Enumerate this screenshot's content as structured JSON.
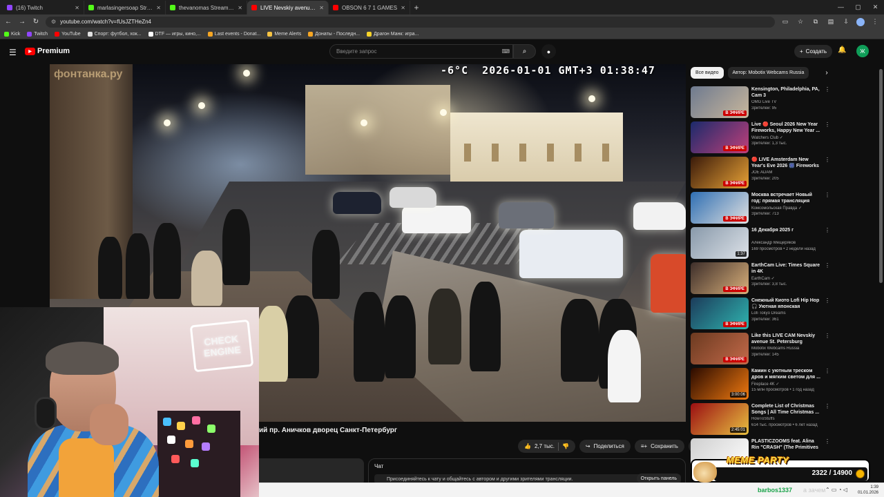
{
  "browser": {
    "tabs": [
      {
        "label": "(16) Twitch",
        "color": "#9146ff",
        "active": false
      },
      {
        "label": "marlasingersoap Stream - Watc",
        "color": "#53fc18",
        "active": false
      },
      {
        "label": "thevanomas Stream - Watch Li",
        "color": "#53fc18",
        "active": false
      },
      {
        "label": "LIVE Nevskiy avenue St. Pe",
        "color": "#ff0000",
        "active": true
      },
      {
        "label": "OBSON 6 7 1 GAMES",
        "color": "#ff0000",
        "active": false
      }
    ],
    "url": "youtube.com/watch?v=fUsJZTHeZn4",
    "bookmarks": [
      {
        "label": "Kick",
        "color": "#53fc18"
      },
      {
        "label": "Twitch",
        "color": "#9146ff"
      },
      {
        "label": "YouTube",
        "color": "#ff0000"
      },
      {
        "label": "Спорт: футбол, хок...",
        "color": "#e0e0e0"
      },
      {
        "label": "DTF — игры, кино,...",
        "color": "#ffffff"
      },
      {
        "label": "Last events - Donat...",
        "color": "#f6a623"
      },
      {
        "label": "Meme Alerts",
        "color": "#f6c343"
      },
      {
        "label": "Донаты - Последн...",
        "color": "#f6a623"
      },
      {
        "label": "Драгон Манк: игра...",
        "color": "#f6d32a"
      }
    ]
  },
  "youtube": {
    "logo_text": "Premium",
    "search_placeholder": "Введите запрос",
    "create_label": "Создать",
    "user_initial": "Ж"
  },
  "video": {
    "overlay_text": "-6°C  2026-01-01 GMT+3 01:38:47",
    "watermark": "фонтанка.ру",
    "title": "ий пр. Аничков дворец Санкт-Петербург",
    "likes": "2,7 тыс.",
    "share_label": "Поделиться",
    "save_label": "Сохранить"
  },
  "webcam": {
    "sign_line1": "CHECK",
    "sign_line2": "ENGINE"
  },
  "chat": {
    "title": "Чат",
    "prompt": "Присоединяйтесь к чату и общайтесь с автором и другими зрителями трансляции.",
    "open_panel": "Открыть панель"
  },
  "sidebar": {
    "chips": [
      "Все видео",
      "Автор: Mobotix Webcams Russia"
    ],
    "items": [
      {
        "title": "Kensington, Philadelphia, PA, Cam 3",
        "channel": "OMG Live TV",
        "meta": "Зрителей: 95",
        "live": true,
        "badge": "В ЭФИРЕ",
        "thumb": [
          "#6e7a8f",
          "#c9b79c"
        ]
      },
      {
        "title": "Live 🔴 Seoul 2026 New Year Fireworks, Happy New Year ...",
        "channel": "Watchers Club ✓",
        "meta": "Зрителей: 1,3 тыс.",
        "live": true,
        "badge": "В ЭФИРЕ",
        "thumb": [
          "#1b2a6b",
          "#c0407a"
        ]
      },
      {
        "title": "🔴 LIVE Amsterdam New Year's Eve 2026 🎆 Fireworks Walk",
        "channel": "JOE ADAM",
        "meta": "Зрителей: 205",
        "live": true,
        "badge": "В ЭФИРЕ",
        "thumb": [
          "#3a1a0a",
          "#e8a236"
        ]
      },
      {
        "title": "Москва встречает Новый год: прямая трансляция",
        "channel": "Комсомольская Правда ✓",
        "meta": "Зрителей: 713",
        "live": true,
        "badge": "В ЭФИРЕ",
        "thumb": [
          "#2f6fb3",
          "#e0e0e0"
        ]
      },
      {
        "title": "16 Декабря 2025 г",
        "channel": "Александр Мещеряков",
        "meta": "169 просмотров • 2 недели назад",
        "live": false,
        "badge": "1:37",
        "thumb": [
          "#8899aa",
          "#dde2e8"
        ]
      },
      {
        "title": "EarthCam Live: Times Square in 4K",
        "channel": "EarthCam ✓",
        "meta": "Зрителей: 3,8 тыс.",
        "live": true,
        "badge": "В ЭФИРЕ",
        "thumb": [
          "#3d2e2a",
          "#d9b07a"
        ]
      },
      {
        "title": "Снежный Киото Lofi Hip Hop 🎧 Уютная японская ретро-...",
        "channel": "Lofi Tokyo Dreams",
        "meta": "Зрителей: 361",
        "live": true,
        "badge": "В ЭФИРЕ",
        "thumb": [
          "#1c3b5a",
          "#2fb5b0"
        ]
      },
      {
        "title": "Like this LIVE CAM Nevskiy avenue St. Petersburg Russia. ...",
        "channel": "Mobotix Webcams Russia",
        "meta": "Зрителей: 145",
        "live": true,
        "badge": "В ЭФИРЕ",
        "thumb": [
          "#6b3a20",
          "#c46a4a"
        ]
      },
      {
        "title": "Камин с уютным треском дров и мягким светом для ...",
        "channel": "Fireplace 4K ✓",
        "meta": "15 млн просмотров • 1 год назад",
        "live": false,
        "badge": "3:00:06",
        "thumb": [
          "#2a0a00",
          "#f07a10"
        ]
      },
      {
        "title": "Complete List of Christmas Songs | All Time Christmas ...",
        "channel": "HowToStuffs",
        "meta": "614 тыс. просмотров • 6 лет назад",
        "live": false,
        "badge": "2:45:01",
        "thumb": [
          "#9a0e12",
          "#e8c040"
        ]
      },
      {
        "title": "PLASTICZOOMS feat. Alina Rin \"CRASH\" (The Primitives Cover)",
        "channel": "",
        "meta": "",
        "live": false,
        "badge": "",
        "thumb": [
          "#cfcfcf",
          "#ffffff"
        ]
      }
    ]
  },
  "meme_party": {
    "title": "MEME PARTY",
    "counter": "2322 / 14900"
  },
  "taskbar": {
    "chat_user": "barbos1337",
    "chat_message": "а зачем",
    "clock_time": "1:39",
    "clock_date": "01.01.2026"
  }
}
